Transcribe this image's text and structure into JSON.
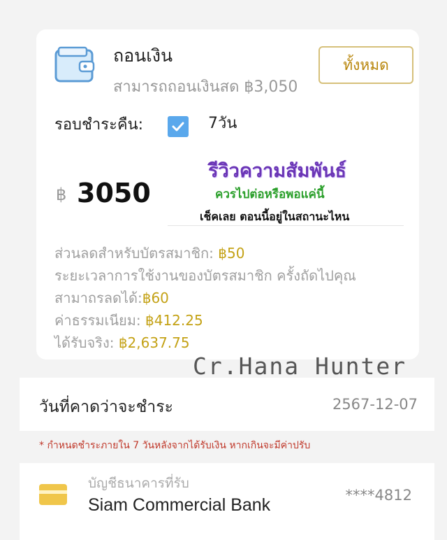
{
  "withdraw": {
    "title": "ถอนเงิน",
    "available_text": "สามารถถอนเงินสด ฿3,050",
    "all_button": "ทั้งหมด"
  },
  "repayment": {
    "label": "รอบชำระคืน:",
    "cycle": "7วัน",
    "checked": true
  },
  "amount": {
    "currency": "฿",
    "value": "3050"
  },
  "promo": {
    "line1": "รีวิวความสัมพันธ์",
    "line2": "ควรไปต่อหรือพอแค่นี้",
    "line3": "เช็คเลย ตอนนี้อยู่ในสถานะไหน"
  },
  "details": {
    "discount_label": "ส่วนลดสำหรับบัตรสมาชิก: ",
    "discount_value": "฿50",
    "next_label_1": "ระยะเวลาการใช้งานของบัตรสมาชิก ครั้งถัดไปคุณ",
    "next_label_2": "สามาถรลดได้:",
    "next_value": "฿60",
    "fee_label": "ค่าธรรมเนียม: ",
    "fee_value": "฿412.25",
    "received_label": "ได้รับจริง: ",
    "received_value": "฿2,637.75"
  },
  "credit": "Cr.Hana_Hunter",
  "due": {
    "label": "วันที่คาดว่าจะชำระ",
    "date": "2567-12-07"
  },
  "note": "* กำหนดชำระภายใน 7 วันหลังจากได้รับเงิน หากเกินจะมีค่าปรับ",
  "bank": {
    "label": "บัญชีธนาคารที่รับ",
    "name": "Siam Commercial Bank",
    "account": "****4812"
  },
  "colors": {
    "accent_gold": "#c4a216",
    "checkbox_blue": "#5aa8ec",
    "promo_purple": "#6a35b5",
    "promo_green": "#2ca02c",
    "note_red": "#c0392b"
  }
}
